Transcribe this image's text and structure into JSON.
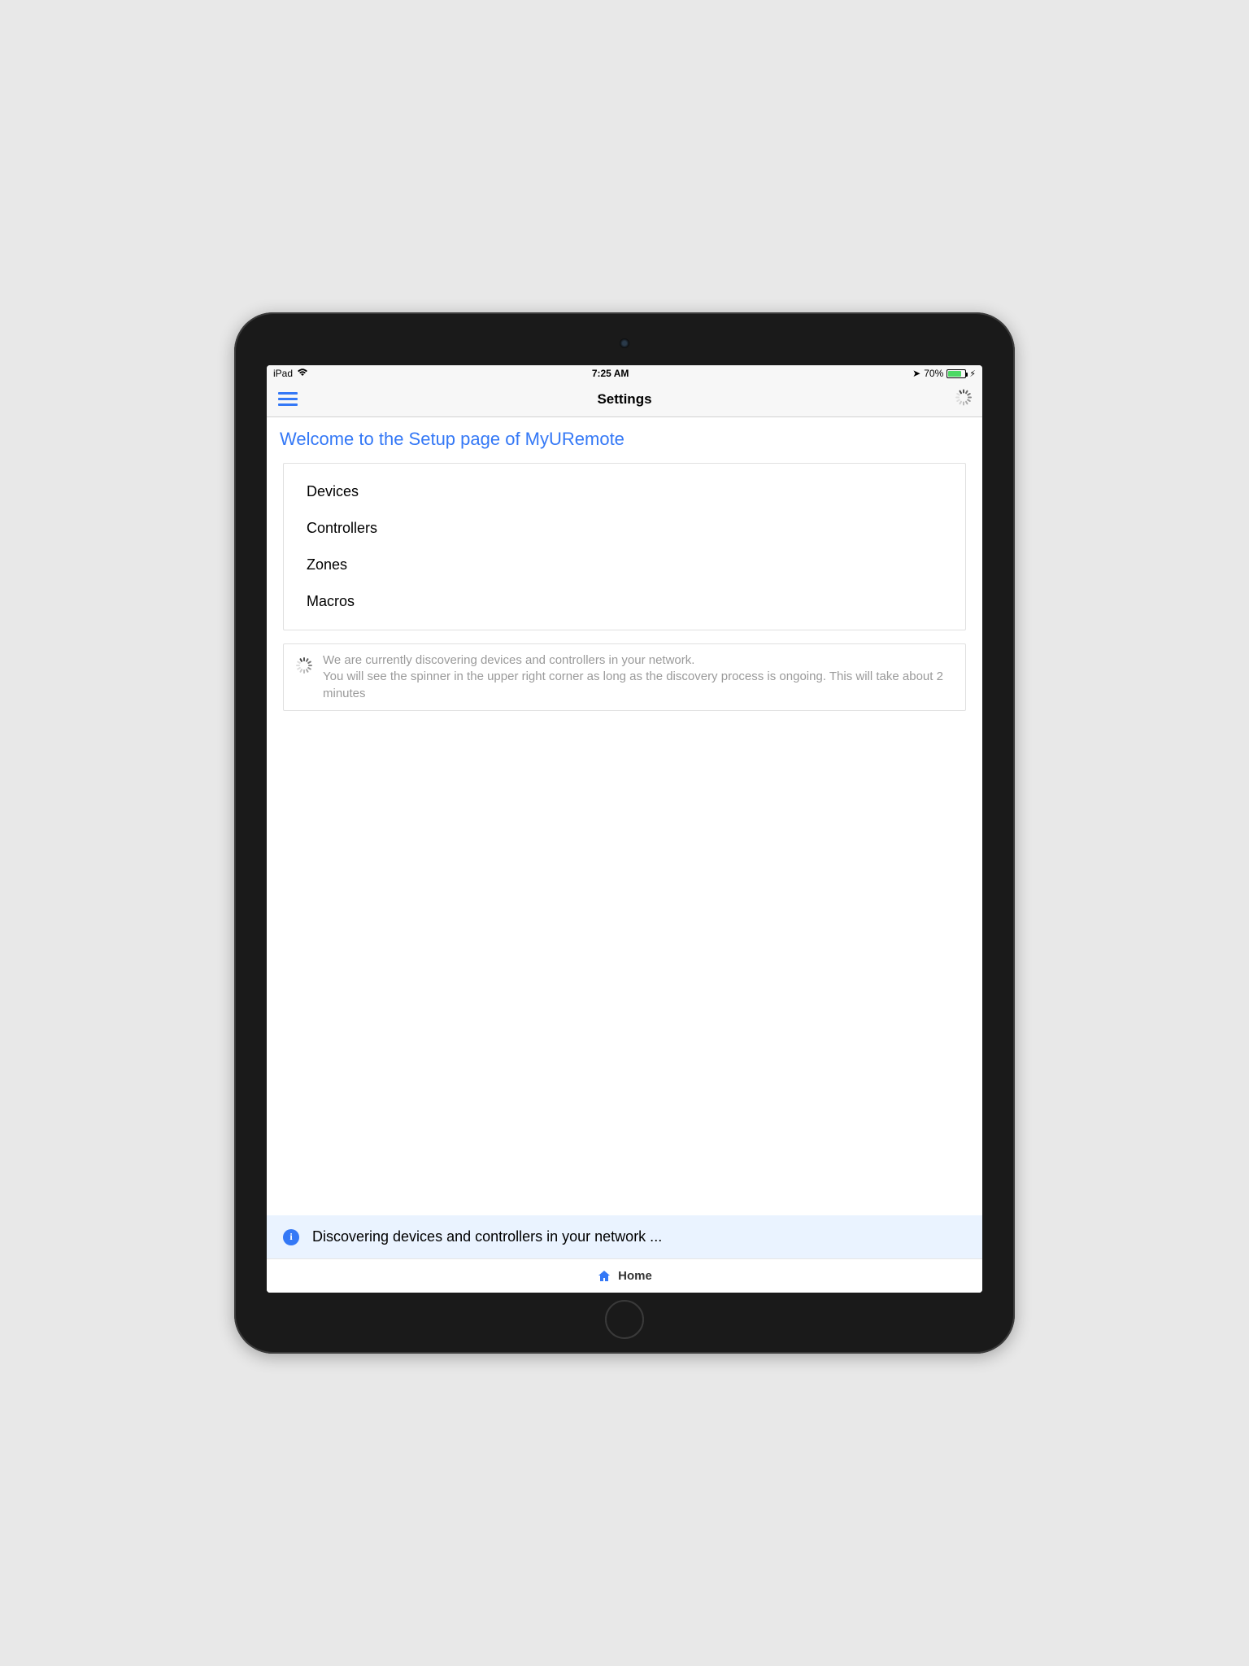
{
  "statusBar": {
    "carrier": "iPad",
    "time": "7:25 AM",
    "batteryPercent": "70%"
  },
  "navBar": {
    "title": "Settings"
  },
  "welcome": {
    "title": "Welcome to the Setup page of MyURemote"
  },
  "menu": {
    "items": [
      {
        "label": "Devices"
      },
      {
        "label": "Controllers"
      },
      {
        "label": "Zones"
      },
      {
        "label": "Macros"
      }
    ]
  },
  "discoveryInfo": {
    "line1": "We are currently discovering devices and controllers in your network.",
    "line2": "You will see the spinner in the upper right corner as long as the discovery process is ongoing. This will take about 2 minutes"
  },
  "statusBanner": {
    "text": "Discovering devices and controllers in your network ..."
  },
  "tabBar": {
    "home": "Home"
  }
}
